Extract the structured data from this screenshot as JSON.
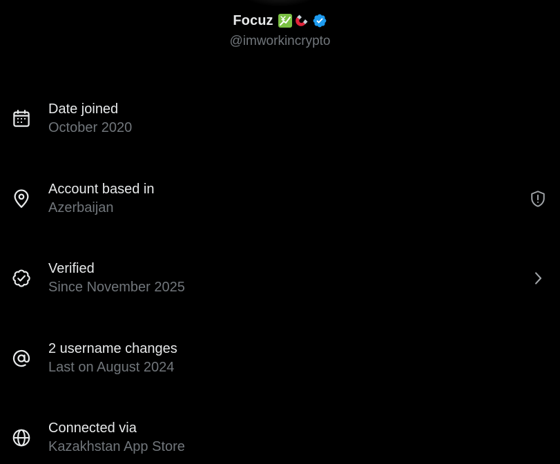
{
  "profile": {
    "display_name": "Focuz",
    "handle": "@imworkincrypto",
    "emojis": [
      "chart-increasing-with-yen-emoji",
      "magnet-emoji"
    ],
    "verified": true,
    "badge_color": "#1d9bf0"
  },
  "rows": [
    {
      "title": "Date joined",
      "subtitle": "October 2020",
      "icon": "calendar-icon"
    },
    {
      "title": "Account based in",
      "subtitle": "Azerbaijan",
      "icon": "location-pin-icon",
      "trailing": "shield-icon"
    },
    {
      "title": "Verified",
      "subtitle": "Since November 2025",
      "icon": "verified-check-icon",
      "trailing": "chevron-right-icon"
    },
    {
      "title": "2 username changes",
      "subtitle": "Last on August 2024",
      "icon": "at-sign-icon"
    },
    {
      "title": "Connected via",
      "subtitle": "Kazakhstan App Store",
      "icon": "globe-icon"
    }
  ],
  "colors": {
    "background": "#000000",
    "primary_text": "#e7e9ea",
    "secondary_text": "#71767b"
  }
}
